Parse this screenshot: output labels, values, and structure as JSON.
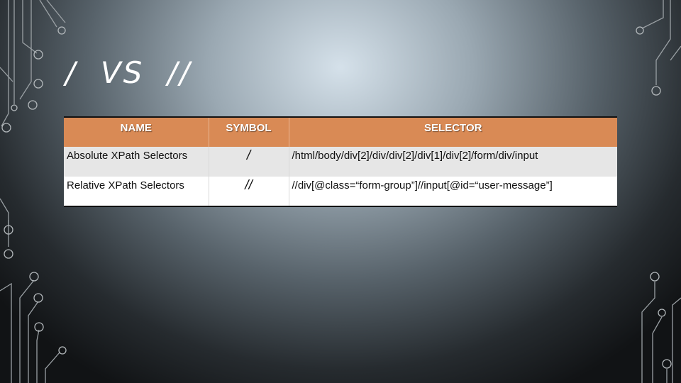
{
  "slide": {
    "title": "/  VS  //",
    "decoration": "circuit-lines"
  },
  "table": {
    "header_color": "#d98a55",
    "headers": [
      "NAME",
      "SYMBOL",
      "SELECTOR"
    ],
    "rows": [
      {
        "name": "Absolute XPath Selectors",
        "symbol": "/",
        "selector": "/html/body/div[2]/div/div[2]/div[1]/div[2]/form/div/input"
      },
      {
        "name": "Relative XPath Selectors",
        "symbol": "//",
        "selector": "//div[@class=“form-group”]//input[@id=“user-message”]"
      }
    ]
  }
}
